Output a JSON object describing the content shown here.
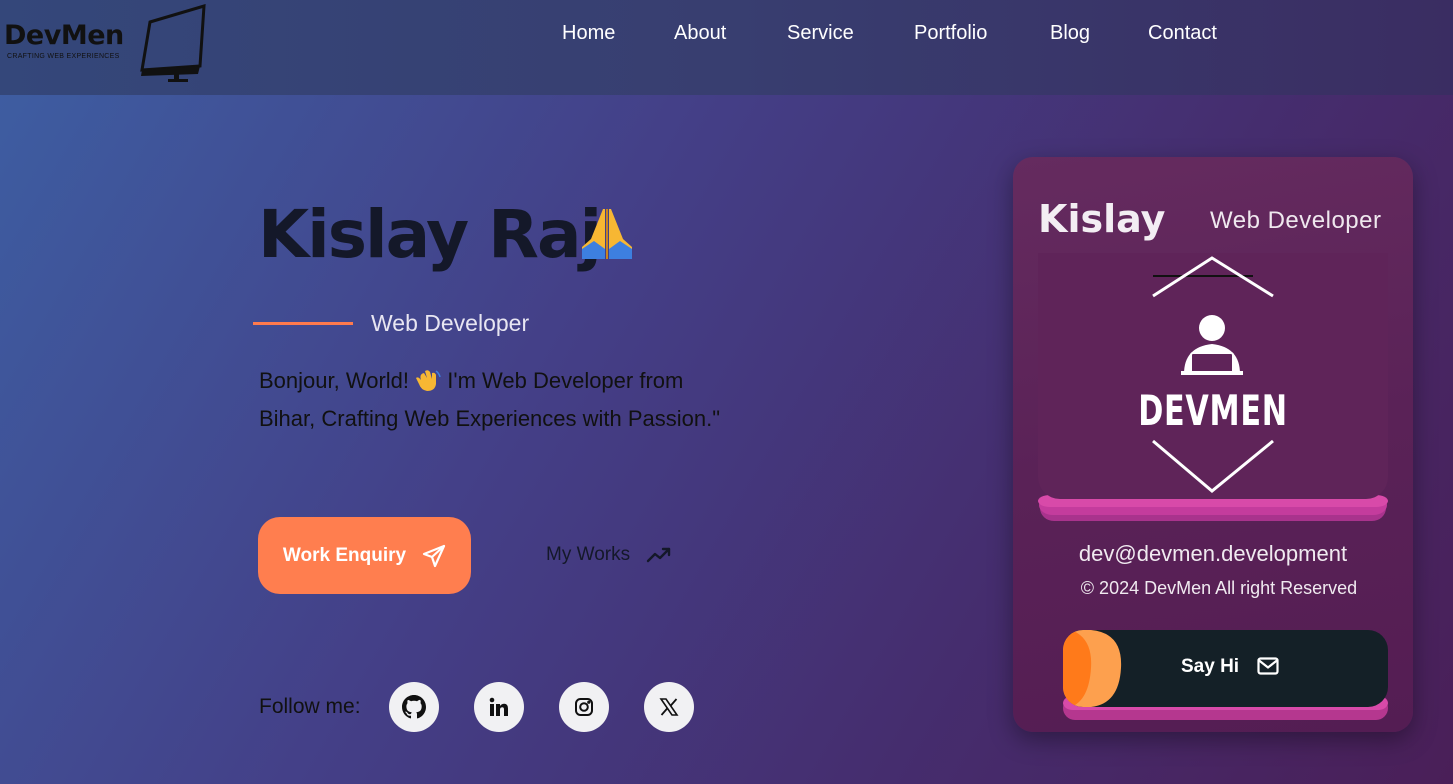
{
  "brand": {
    "name": "DevMen",
    "tagline": "CRAFTING WEB EXPERIENCES"
  },
  "nav": {
    "items": [
      "Home",
      "About",
      "Service",
      "Portfolio",
      "Blog",
      "Contact"
    ]
  },
  "hero": {
    "name": "Kislay Raj",
    "role": "Web Developer",
    "intro_part1": "Bonjour, World!",
    "intro_part2": " I'm Web Developer from Bihar, Crafting Web Experiences with Passion.\"",
    "work_enquiry_label": "Work Enquiry",
    "my_works_label": "My Works",
    "follow_label": "Follow me:"
  },
  "social": [
    "github-icon",
    "linkedin-icon",
    "instagram-icon",
    "x-icon"
  ],
  "card": {
    "name": "Kislay",
    "role": "Web Developer",
    "logo_text": "DEVMEN",
    "email": "dev@devmen.development",
    "copyright": "© 2024 DevMen All right Reserved",
    "say_hi_label": "Say Hi"
  },
  "colors": {
    "accent_orange": "#ff7e4f",
    "card_bg": "#5a2257",
    "card_stripe": "#c0389a",
    "button_dark": "#142027"
  }
}
